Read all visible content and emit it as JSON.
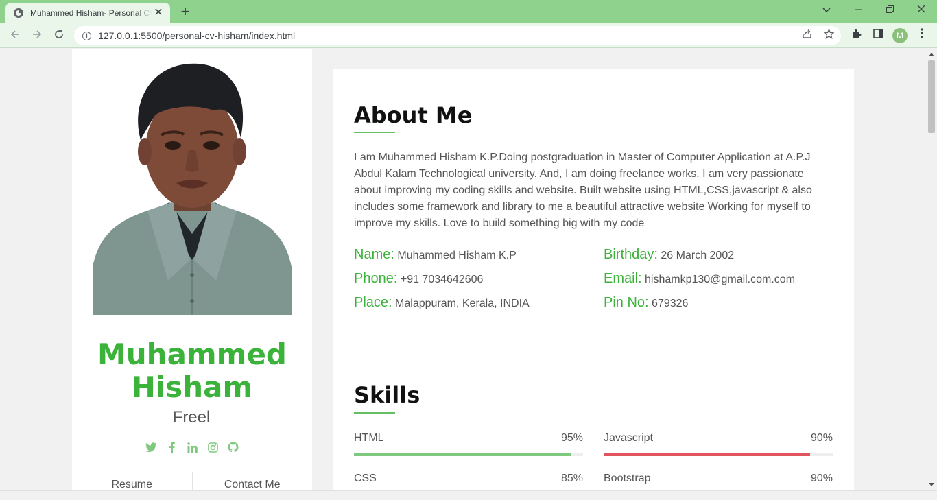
{
  "browser": {
    "tab_title": "Muhammed Hisham- Personal CV",
    "tab_close": "✕",
    "new_tab": "+",
    "url": "127.0.0.1:5500/personal-cv-hisham/index.html",
    "profile_initial": "M",
    "theme_color": "#8fd28e"
  },
  "sidebar": {
    "name": "Muhammed Hisham",
    "typed_text": "Freel",
    "socials": [
      "twitter-icon",
      "facebook-icon",
      "linkedin-icon",
      "instagram-icon",
      "github-icon"
    ],
    "links": [
      "Resume",
      "Contact Me"
    ],
    "accent": "#3bb23a"
  },
  "about": {
    "title": "About Me",
    "text": "I am Muhammed Hisham K.P.Doing postgraduation in Master of Computer Application at A.P.J Abdul Kalam Technological university. And, I am doing freelance works. I am very passionate about improving my coding skills and website. Built website using HTML,CSS,javascript & also includes some framework and library to me a beautiful attractive website Working for myself to improve my skills. Love to build something big with my code",
    "info": [
      {
        "key": "Name:",
        "value": "Muhammed Hisham K.P"
      },
      {
        "key": "Birthday:",
        "value": "26 March 2002"
      },
      {
        "key": "Phone:",
        "value": "+91 7034642606"
      },
      {
        "key": "Email:",
        "value": "hishamkp130@gmail.com.com"
      },
      {
        "key": "Place:",
        "value": "Malappuram, Kerala, INDIA"
      },
      {
        "key": "Pin No:",
        "value": "679326"
      }
    ]
  },
  "skills": {
    "title": "Skills",
    "items": [
      {
        "name": "HTML",
        "percent": "95%",
        "level": 0.95,
        "color": "#7fc97e"
      },
      {
        "name": "Javascript",
        "percent": "90%",
        "level": 0.9,
        "color": "#e0555f"
      },
      {
        "name": "CSS",
        "percent": "85%",
        "level": 0.85,
        "color": "#7fc97e"
      },
      {
        "name": "Bootstrap",
        "percent": "90%",
        "level": 0.9,
        "color": "#e0555f"
      }
    ]
  }
}
